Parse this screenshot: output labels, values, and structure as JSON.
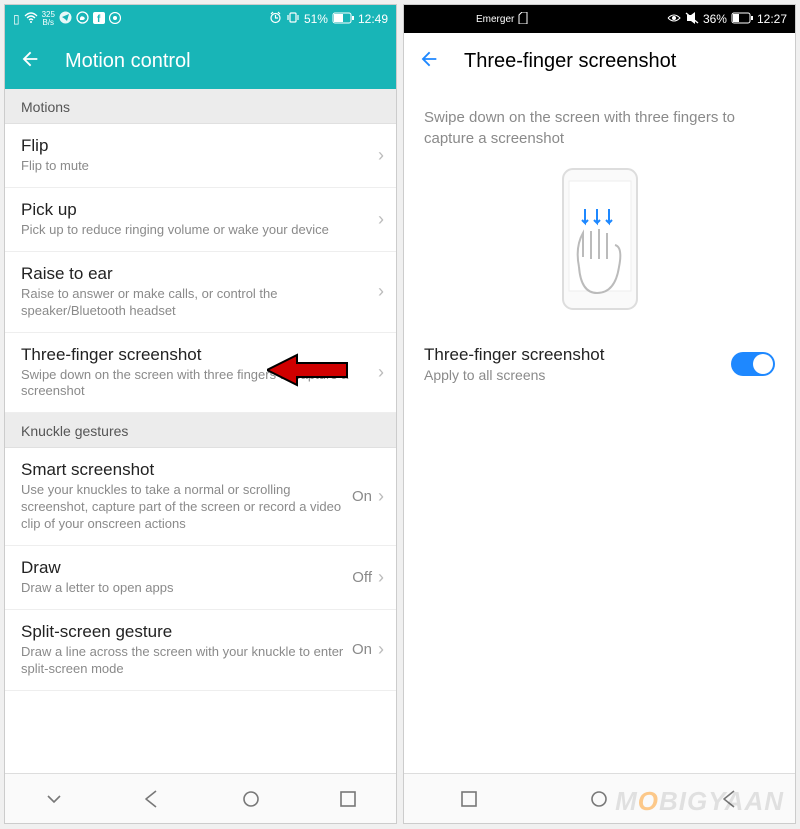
{
  "left": {
    "status": {
      "bps": "325",
      "bps_unit": "B/s",
      "battery_pct": "51%",
      "time": "12:49"
    },
    "title": "Motion control",
    "sections": [
      {
        "header": "Motions",
        "items": [
          {
            "title": "Flip",
            "sub": "Flip to mute",
            "value": ""
          },
          {
            "title": "Pick up",
            "sub": "Pick up to reduce ringing volume or wake your device",
            "value": ""
          },
          {
            "title": "Raise to ear",
            "sub": "Raise to answer or make calls, or control the speaker/Bluetooth headset",
            "value": ""
          },
          {
            "title": "Three-finger screenshot",
            "sub": "Swipe down on the screen with three fingers to capture a screenshot",
            "value": ""
          }
        ]
      },
      {
        "header": "Knuckle gestures",
        "items": [
          {
            "title": "Smart screenshot",
            "sub": "Use your knuckles to take a normal or scrolling screenshot, capture part of the screen or record a video clip of your onscreen actions",
            "value": "On"
          },
          {
            "title": "Draw",
            "sub": "Draw a letter to open apps",
            "value": "Off"
          },
          {
            "title": "Split-screen gesture",
            "sub": "Draw a line across the screen with your knuckle to enter split-screen mode",
            "value": "On"
          }
        ]
      }
    ]
  },
  "right": {
    "status": {
      "carrier": "Emerger",
      "battery_pct": "36%",
      "time": "12:27"
    },
    "title": "Three-finger screenshot",
    "description": "Swipe down on the screen with three fingers to capture a screenshot",
    "toggle": {
      "title": "Three-finger screenshot",
      "sub": "Apply to all screens",
      "on": true
    }
  },
  "watermark": {
    "a": "M",
    "b": "O",
    "c": "BIGYAAN"
  }
}
